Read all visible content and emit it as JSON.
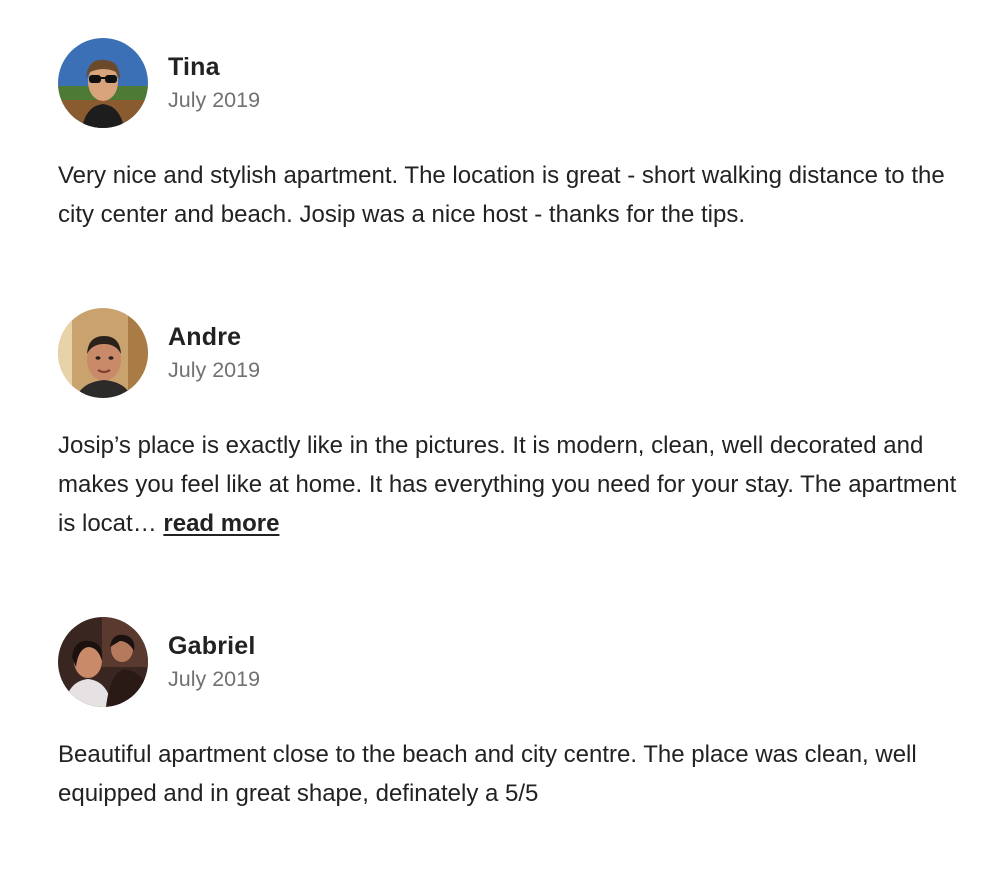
{
  "reviews": [
    {
      "name": "Tina",
      "date": "July 2019",
      "text": "Very nice and stylish apartment. The location is great - short walking distance to the city center and beach. Josip was a nice host - thanks for the tips."
    },
    {
      "name": "Andre",
      "date": "July 2019",
      "text": "Josip’s place is exactly like in the pictures. It is modern, clean, well decorated and makes you feel like at home. It has everything you need for your stay. The apartment is locat… ",
      "read_more_label": "read more"
    },
    {
      "name": "Gabriel",
      "date": "July 2019",
      "text": "Beautiful apartment close to the beach and city centre. The place was clean, well equipped and in great shape, definately a 5/5"
    }
  ]
}
